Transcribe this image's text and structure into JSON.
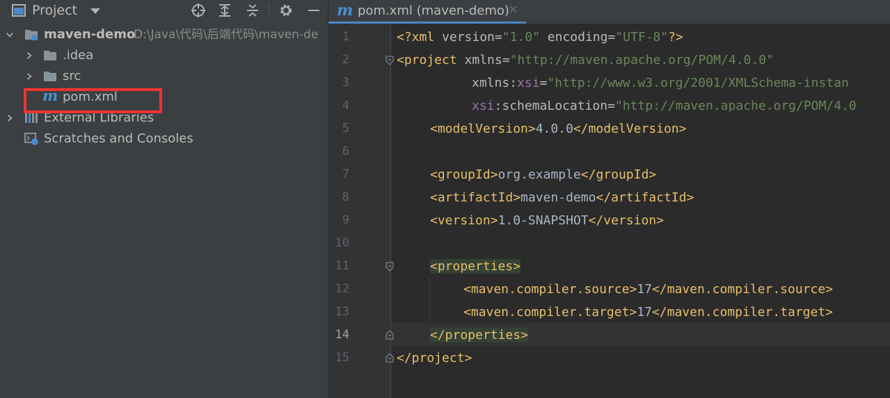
{
  "project_panel": {
    "title": "Project",
    "tree": [
      {
        "label": "maven-demo",
        "path": "D:\\Java\\代码\\后端代码\\maven-de"
      },
      {
        "label": ".idea"
      },
      {
        "label": "src"
      },
      {
        "label": "pom.xml",
        "icon_letter": "m"
      },
      {
        "label": "External Libraries"
      },
      {
        "label": "Scratches and Consoles"
      }
    ],
    "icons": [
      "project-window-icon",
      "dropdown-icon",
      "locate-icon",
      "expand-all-icon",
      "collapse-all-icon",
      "settings-icon",
      "hide-icon"
    ]
  },
  "editor": {
    "tab": {
      "icon_letter": "m",
      "label": "pom.xml (maven-demo)",
      "close": "×"
    },
    "line_numbers": [
      "1",
      "2",
      "3",
      "4",
      "5",
      "6",
      "7",
      "8",
      "9",
      "10",
      "11",
      "12",
      "13",
      "14",
      "15"
    ],
    "current_line": "14",
    "code": {
      "l1": {
        "a": "<?xml ",
        "b": "version",
        "c": "=",
        "d": "\"1.0\"",
        "e": " encoding",
        "f": "=",
        "g": "\"UTF-8\"",
        "h": "?>"
      },
      "l2": {
        "a": "<project ",
        "b": "xmlns",
        "c": "=",
        "d": "\"http://maven.apache.org/POM/4.0.0\""
      },
      "l3": {
        "a": "xmlns:",
        "b": "xsi",
        "c": "=",
        "d": "\"http://www.w3.org/2001/XMLSchema-instan"
      },
      "l4": {
        "a": "xsi",
        "b": ":schemaLocation",
        "c": "=",
        "d": "\"http://maven.apache.org/POM/4.0"
      },
      "l5": {
        "a": "<modelVersion>",
        "b": "4.0.0",
        "c": "</modelVersion>"
      },
      "l7": {
        "a": "<groupId>",
        "b": "org.example",
        "c": "</groupId>"
      },
      "l8": {
        "a": "<artifactId>",
        "b": "maven-demo",
        "c": "</artifactId>"
      },
      "l9": {
        "a": "<version>",
        "b": "1.0-SNAPSHOT",
        "c": "</version>"
      },
      "l11": {
        "a": "<properties>"
      },
      "l12": {
        "a": "<maven.compiler.source>",
        "b": "17",
        "c": "</maven.compiler.source>"
      },
      "l13": {
        "a": "<maven.compiler.target>",
        "b": "17",
        "c": "</maven.compiler.target>"
      },
      "l14": {
        "a": "</properties>"
      },
      "l15": {
        "a": "</project>"
      }
    }
  },
  "colors": {
    "panel_bg": "#3c3f41",
    "editor_bg": "#2b2b2b",
    "tag": "#e8bf6a",
    "string": "#6a8759",
    "namespace": "#9876aa",
    "highlight_box": "#ef3331",
    "maven_icon": "#4a8fd1"
  }
}
